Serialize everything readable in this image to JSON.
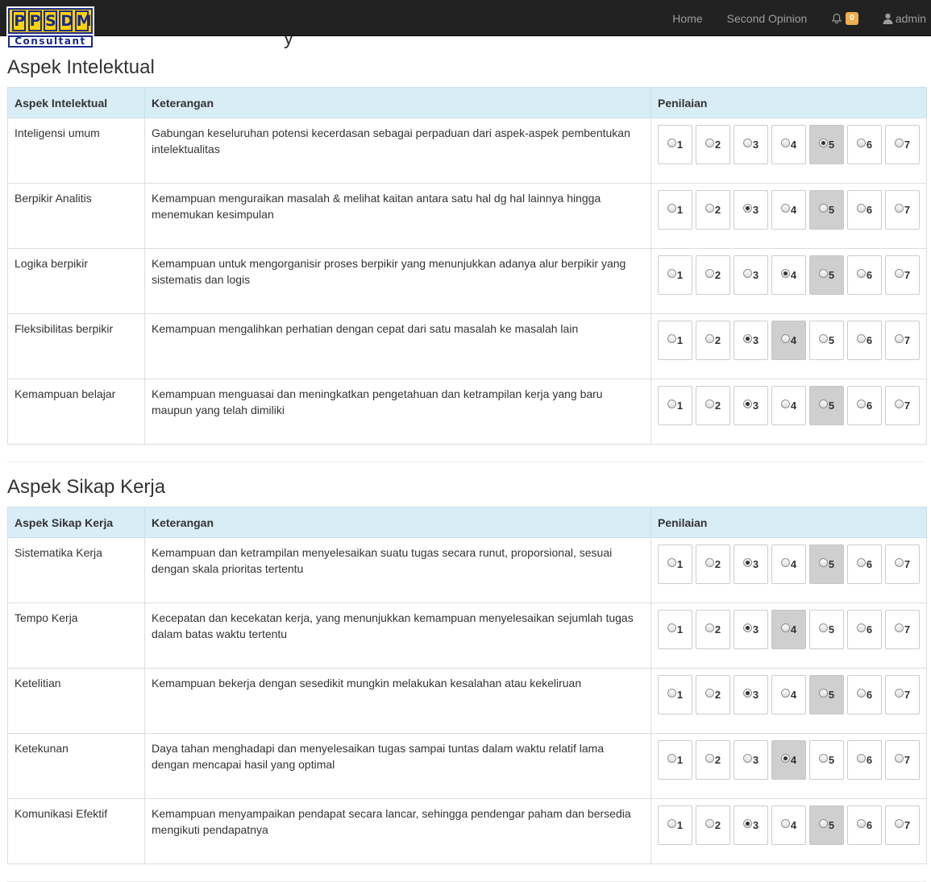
{
  "navbar": {
    "logo_top": [
      "P",
      "P",
      "S",
      "D",
      "M"
    ],
    "logo_bottom": "Consultant",
    "home": "Home",
    "second_opinion": "Second Opinion",
    "notif_count": "0",
    "user": "admin"
  },
  "hidden_title_fragment": "y",
  "sections": [
    {
      "title": "Aspek Intelektual",
      "headers": [
        "Aspek Intelektual",
        "Keterangan",
        "Penilaian"
      ],
      "rows": [
        {
          "name": "Inteligensi umum",
          "desc": "Gabungan keseluruhan potensi kecerdasan sebagai perpaduan dari aspek-aspek pembentukan intelektualitas",
          "selected": 5,
          "highlight": 5
        },
        {
          "name": "Berpikir Analitis",
          "desc": "Kemampuan menguraikan masalah & melihat kaitan antara satu hal dg hal lainnya hingga menemukan kesimpulan",
          "selected": 3,
          "highlight": 5
        },
        {
          "name": "Logika berpikir",
          "desc": "Kemampuan untuk mengorganisir proses berpikir yang menunjukkan adanya alur berpikir yang sistematis dan logis",
          "selected": 4,
          "highlight": 5
        },
        {
          "name": "Fleksibilitas berpikir",
          "desc": "Kemampuan mengalihkan perhatian dengan cepat dari satu masalah ke masalah lain",
          "selected": 3,
          "highlight": 4
        },
        {
          "name": "Kemampuan belajar",
          "desc": "Kemampuan menguasai dan meningkatkan pengetahuan dan ketrampilan kerja yang baru maupun yang telah dimiliki",
          "selected": 3,
          "highlight": 5
        }
      ]
    },
    {
      "title": "Aspek Sikap Kerja",
      "headers": [
        "Aspek Sikap Kerja",
        "Keterangan",
        "Penilaian"
      ],
      "rows": [
        {
          "name": "Sistematika Kerja",
          "desc": "Kemampuan dan ketrampilan menyelesaikan suatu tugas secara runut, proporsional, sesuai dengan skala prioritas tertentu",
          "selected": 3,
          "highlight": 5
        },
        {
          "name": "Tempo Kerja",
          "desc": "Kecepatan dan kecekatan kerja, yang menunjukkan kemampuan menyelesaikan sejumlah tugas dalam batas waktu tertentu",
          "selected": 3,
          "highlight": 4
        },
        {
          "name": "Ketelitian",
          "desc": "Kemampuan bekerja dengan sesedikit mungkin melakukan kesalahan atau kekeliruan",
          "selected": 3,
          "highlight": 5
        },
        {
          "name": "Ketekunan",
          "desc": "Daya tahan menghadapi dan menyelesaikan tugas sampai tuntas dalam waktu relatif lama dengan mencapai hasil yang optimal",
          "selected": 4,
          "highlight": 4
        },
        {
          "name": "Komunikasi Efektif",
          "desc": "Kemampuan menyampaikan pendapat secara lancar, sehingga pendengar paham dan bersedia mengikuti pendapatnya",
          "selected": 3,
          "highlight": 5
        }
      ]
    }
  ],
  "scale": [
    "1",
    "2",
    "3",
    "4",
    "5",
    "6",
    "7"
  ]
}
